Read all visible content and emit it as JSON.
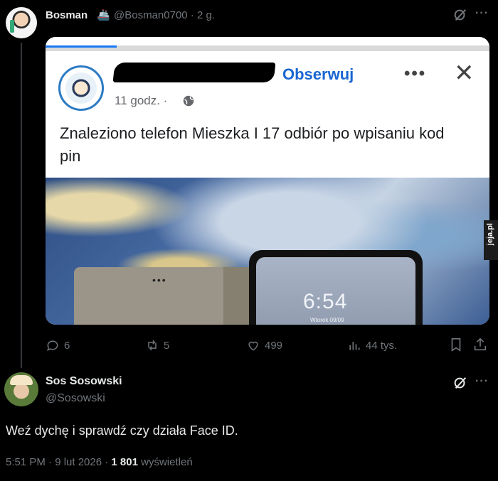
{
  "tweet": {
    "author_name": "Bosman",
    "author_emoji": "🚢",
    "handle": "@Bosman0700",
    "age": "· 2 g.",
    "more_icon": "more-icon",
    "grok_icon": "grok-icon"
  },
  "embed": {
    "follow_label": "Obserwuj",
    "more_label": "•••",
    "close_label": "✕",
    "time_label": "11 godz. ·",
    "post_text": "Znaleziono telefon Mieszka I 17 odbiór po wpisaniu kod pin",
    "phone_clock": "6:54",
    "phone_date": "Wtorek 09/09",
    "watermark": "jeja.pl"
  },
  "actions": {
    "replies": "6",
    "reposts": "5",
    "likes": "499",
    "views": "44 tys."
  },
  "reply": {
    "author_name": "Sos Sosowski",
    "handle": "@Sosowski",
    "text": "Weź dychę i sprawdź czy działa Face ID.",
    "time": "5:51 PM · 9 lut 2026 · ",
    "views_count": "1 801",
    "views_label": " wyświetleń"
  },
  "colors": {
    "background": "#000000",
    "text": "#e7e9ea",
    "muted": "#71767b",
    "fb_blue": "#1a66d2"
  }
}
